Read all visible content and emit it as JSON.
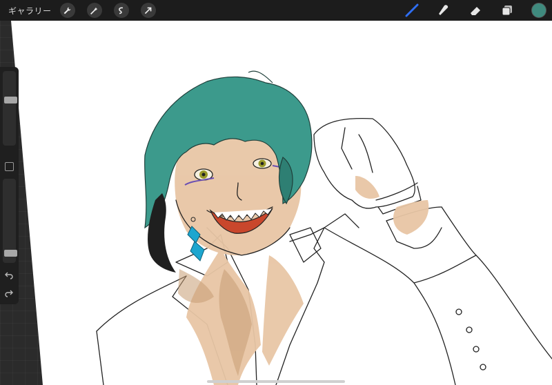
{
  "toolbar": {
    "gallery_label": "ギャラリー",
    "left_tools": [
      {
        "icon": "wrench-icon"
      },
      {
        "icon": "magic-wand-icon"
      },
      {
        "icon": "selection-icon"
      },
      {
        "icon": "transform-arrow-icon"
      }
    ],
    "right_tools": [
      {
        "icon": "brush-icon",
        "active": true
      },
      {
        "icon": "smudge-icon",
        "active": false
      },
      {
        "icon": "eraser-icon",
        "active": false
      },
      {
        "icon": "layers-icon",
        "active": false
      }
    ],
    "current_color": "#3f8a7e",
    "active_tool_color": "#2f6ef2"
  },
  "sidebar": {
    "brush_size_level": 0.62,
    "opacity_level": 0.08
  },
  "artwork": {
    "hair_color": "#3c9a8c",
    "skin_color": "#e9c7a6",
    "earring_color": "#1da6cf"
  }
}
